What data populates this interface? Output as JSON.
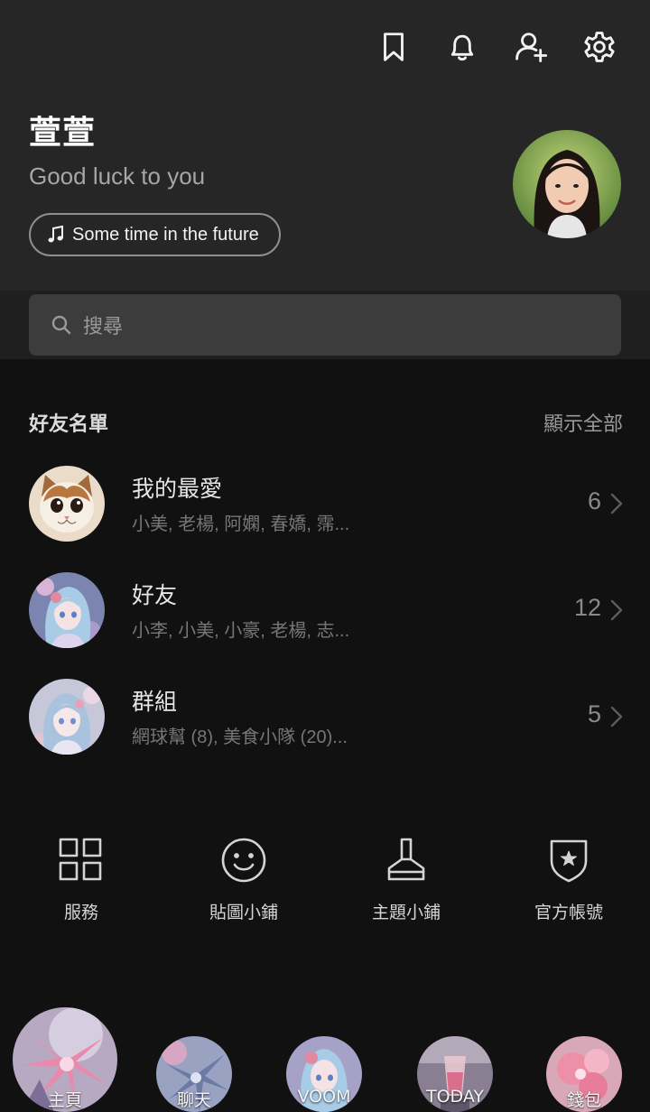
{
  "header": {
    "icons": [
      "bookmark-icon",
      "bell-icon",
      "add-friend-icon",
      "gear-icon"
    ],
    "profile": {
      "name": "萱萱",
      "status": "Good luck to you",
      "music": "Some time in the future"
    }
  },
  "search": {
    "placeholder": "搜尋"
  },
  "friends_section": {
    "title": "好友名單",
    "show_all": "顯示全部",
    "rows": [
      {
        "title": "我的最愛",
        "subtitle": "小美, 老楊, 阿嫻, 春嬌, 霈...",
        "count": "6",
        "thumb": "cat-avatar"
      },
      {
        "title": "好友",
        "subtitle": "小李, 小美, 小豪, 老楊, 志...",
        "count": "12",
        "thumb": "anime-girl-avatar"
      },
      {
        "title": "群組",
        "subtitle": "網球幫 (8), 美食小隊 (20)...",
        "count": "5",
        "thumb": "anime-girl-avatar"
      }
    ]
  },
  "services": [
    {
      "label": "服務",
      "icon": "grid-icon"
    },
    {
      "label": "貼圖小鋪",
      "icon": "smiley-icon"
    },
    {
      "label": "主題小鋪",
      "icon": "brush-icon"
    },
    {
      "label": "官方帳號",
      "icon": "shield-star-icon"
    }
  ],
  "tabbar": [
    {
      "label": "主頁",
      "active": true
    },
    {
      "label": "聊天",
      "active": false
    },
    {
      "label": "VOOM",
      "active": false
    },
    {
      "label": "TODAY",
      "active": false
    },
    {
      "label": "錢包",
      "active": false
    }
  ],
  "colors": {
    "header_bg": "#262626",
    "page_bg": "#111111",
    "search_bg": "#3c3c3c",
    "text_primary": "#e8e8e8",
    "text_secondary": "#767676"
  }
}
